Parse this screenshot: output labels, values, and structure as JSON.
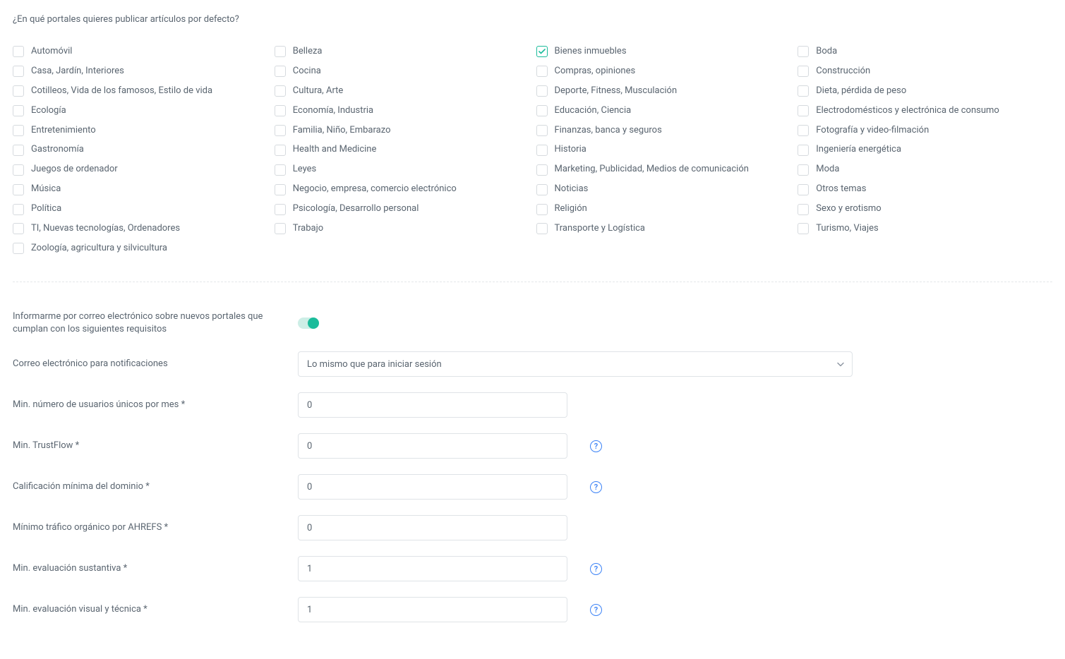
{
  "section_title": "¿En qué portales quieres publicar artículos por defecto?",
  "portals": [
    {
      "label": "Automóvil",
      "checked": false
    },
    {
      "label": "Belleza",
      "checked": false
    },
    {
      "label": "Bienes inmuebles",
      "checked": true
    },
    {
      "label": "Boda",
      "checked": false
    },
    {
      "label": "Casa, Jardín, Interiores",
      "checked": false
    },
    {
      "label": "Cocina",
      "checked": false
    },
    {
      "label": "Compras, opiniones",
      "checked": false
    },
    {
      "label": "Construcción",
      "checked": false
    },
    {
      "label": "Cotilleos, Vida de los famosos, Estilo de vida",
      "checked": false
    },
    {
      "label": "Cultura, Arte",
      "checked": false
    },
    {
      "label": "Deporte, Fitness, Musculación",
      "checked": false
    },
    {
      "label": "Dieta, pérdida de peso",
      "checked": false
    },
    {
      "label": "Ecología",
      "checked": false
    },
    {
      "label": "Economía, Industria",
      "checked": false
    },
    {
      "label": "Educación, Ciencia",
      "checked": false
    },
    {
      "label": "Electrodomésticos y electrónica de consumo",
      "checked": false
    },
    {
      "label": "Entretenimiento",
      "checked": false
    },
    {
      "label": "Familia, Niño, Embarazo",
      "checked": false
    },
    {
      "label": "Finanzas, banca y seguros",
      "checked": false
    },
    {
      "label": "Fotografía y video-filmación",
      "checked": false
    },
    {
      "label": "Gastronomía",
      "checked": false
    },
    {
      "label": "Health and Medicine",
      "checked": false
    },
    {
      "label": "Historia",
      "checked": false
    },
    {
      "label": "Ingeniería energética",
      "checked": false
    },
    {
      "label": "Juegos de ordenador",
      "checked": false
    },
    {
      "label": "Leyes",
      "checked": false
    },
    {
      "label": "Marketing, Publicidad, Medios de comunicación",
      "checked": false
    },
    {
      "label": "Moda",
      "checked": false
    },
    {
      "label": "Música",
      "checked": false
    },
    {
      "label": "Negocio, empresa, comercio electrónico",
      "checked": false
    },
    {
      "label": "Noticias",
      "checked": false
    },
    {
      "label": "Otros temas",
      "checked": false
    },
    {
      "label": "Política",
      "checked": false
    },
    {
      "label": "Psicología, Desarrollo personal",
      "checked": false
    },
    {
      "label": "Religión",
      "checked": false
    },
    {
      "label": "Sexo y erotismo",
      "checked": false
    },
    {
      "label": "TI, Nuevas tecnologías, Ordenadores",
      "checked": false
    },
    {
      "label": "Trabajo",
      "checked": false
    },
    {
      "label": "Transporte y Logística",
      "checked": false
    },
    {
      "label": "Turismo, Viajes",
      "checked": false
    },
    {
      "label": "Zoología, agricultura y silvicultura",
      "checked": false
    }
  ],
  "form": {
    "notify_label": "Informarme por correo electrónico sobre nuevos portales que cumplan con los siguientes requisitos",
    "notify_on": true,
    "email_label": "Correo electrónico para notificaciones",
    "email_value": "Lo mismo que para iniciar sesión",
    "min_users_label": "Min. número de usuarios únicos por mes *",
    "min_users_value": "0",
    "min_trustflow_label": "Min. TrustFlow *",
    "min_trustflow_value": "0",
    "min_domain_label": "Calificación mínima del dominio *",
    "min_domain_value": "0",
    "min_ahrefs_label": "Mínimo tráfico orgánico por AHREFS *",
    "min_ahrefs_value": "0",
    "min_substantive_label": "Min. evaluación sustantiva *",
    "min_substantive_value": "1",
    "min_visual_label": "Min. evaluación visual y técnica *",
    "min_visual_value": "1"
  }
}
